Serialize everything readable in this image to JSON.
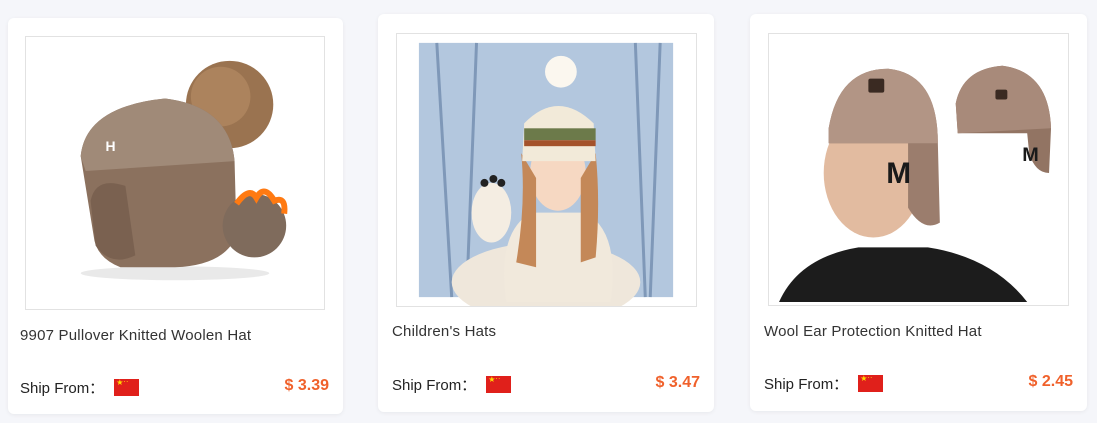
{
  "products": [
    {
      "title": "9907 Pullover Knitted Woolen Hat",
      "ship_label": "Ship From：",
      "price": "$ 3.39",
      "image_icon": "pompom-knit-hat-image"
    },
    {
      "title": "Children's Hats",
      "ship_label": "Ship From：",
      "price": "$ 3.47",
      "image_icon": "child-winter-hat-image"
    },
    {
      "title": "Wool Ear Protection Knitted Hat",
      "ship_label": "Ship From：",
      "price": "$ 2.45",
      "image_icon": "ear-protection-hat-image"
    }
  ],
  "colors": {
    "price": "#f0612b",
    "flag_red": "#e0201b",
    "flag_star": "#ffde00"
  }
}
